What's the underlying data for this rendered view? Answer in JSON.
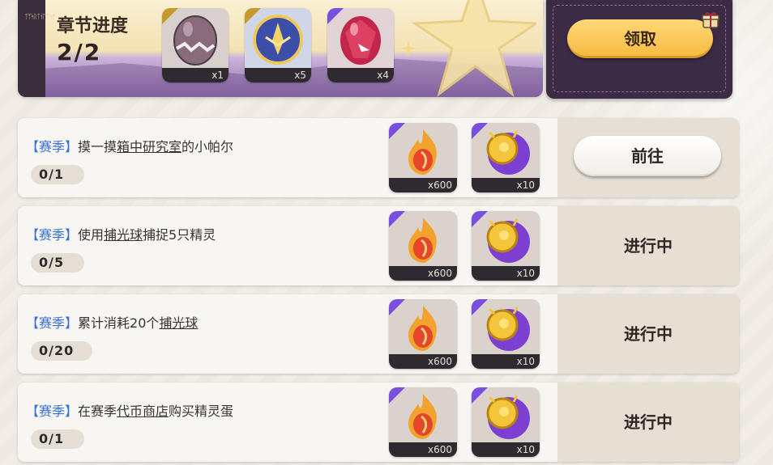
{
  "chapter": {
    "title": "章节进度",
    "progress": "2/2",
    "side_code": "ᛏᛉᛋᚱᛏᚾᛖᛏᛋᚠ",
    "rewards": [
      {
        "icon": "purple-egg-icon",
        "qty": "x1"
      },
      {
        "icon": "blue-crystal-orb-icon",
        "qty": "x5"
      },
      {
        "icon": "red-crystal-egg-icon",
        "qty": "x4"
      }
    ],
    "claim_label": "领取"
  },
  "tasks": [
    {
      "tag": "【赛季】",
      "text_before": "摸一摸",
      "link": "箱中研究室",
      "text_after": "的小帕尔",
      "progress": "0/1",
      "rewards": [
        {
          "icon": "fire-coin-icon",
          "qty": "x600"
        },
        {
          "icon": "gold-purple-token-icon",
          "qty": "x10"
        }
      ],
      "action": "前往"
    },
    {
      "tag": "【赛季】",
      "text_before": "使用",
      "link": "捕光球",
      "text_after": "捕捉5只精灵",
      "progress": "0/5",
      "rewards": [
        {
          "icon": "fire-coin-icon",
          "qty": "x600"
        },
        {
          "icon": "gold-purple-token-icon",
          "qty": "x10"
        }
      ],
      "action": "进行中"
    },
    {
      "tag": "【赛季】",
      "text_before": "累计消耗20个",
      "link": "捕光球",
      "text_after": "",
      "progress": "0/20",
      "rewards": [
        {
          "icon": "fire-coin-icon",
          "qty": "x600"
        },
        {
          "icon": "gold-purple-token-icon",
          "qty": "x10"
        }
      ],
      "action": "进行中"
    },
    {
      "tag": "【赛季】",
      "text_before": "在赛季",
      "link": "代币商店",
      "text_after": "购买精灵蛋",
      "progress": "0/1",
      "rewards": [
        {
          "icon": "fire-coin-icon",
          "qty": "x600"
        },
        {
          "icon": "gold-purple-token-icon",
          "qty": "x10"
        }
      ],
      "action": "进行中"
    }
  ],
  "colors": {
    "tag_blue": "#3a72d8",
    "claim_gold": "#f6b93e",
    "panel_purple": "#3b2b45",
    "rarity_purple": "#7a4fe0",
    "rarity_gold": "#c49a2b"
  }
}
